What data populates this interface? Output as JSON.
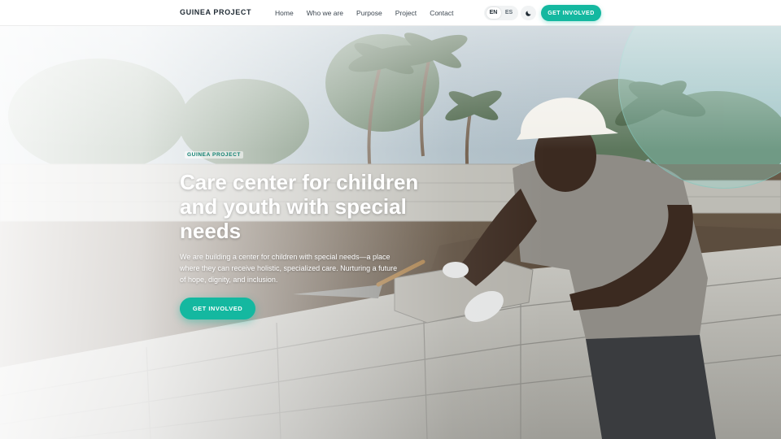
{
  "navbar": {
    "brand": "GUINEA PROJECT",
    "links": [
      "Home",
      "Who we are",
      "Purpose",
      "Project",
      "Contact"
    ],
    "languages": [
      "EN",
      "ES"
    ],
    "active_language": "EN",
    "theme_icon": "moon-icon",
    "cta_label": "GET INVOLVED"
  },
  "hero": {
    "eyebrow": "GUINEA PROJECT",
    "title": "Care center for children and youth with special needs",
    "subtitle": "We are building a center for children with special needs—a place where they can receive holistic, specialized care. Nurturing a future of hope, dignity, and inclusion.",
    "cta_label": "GET INVOLVED",
    "image_subject": "Construction worker in a white hard hat laying concrete blocks on a site surrounded by palm trees"
  },
  "colors": {
    "accent": "#14b8a0",
    "brand_text": "#1f2a33",
    "nav_text": "#3c4650"
  }
}
